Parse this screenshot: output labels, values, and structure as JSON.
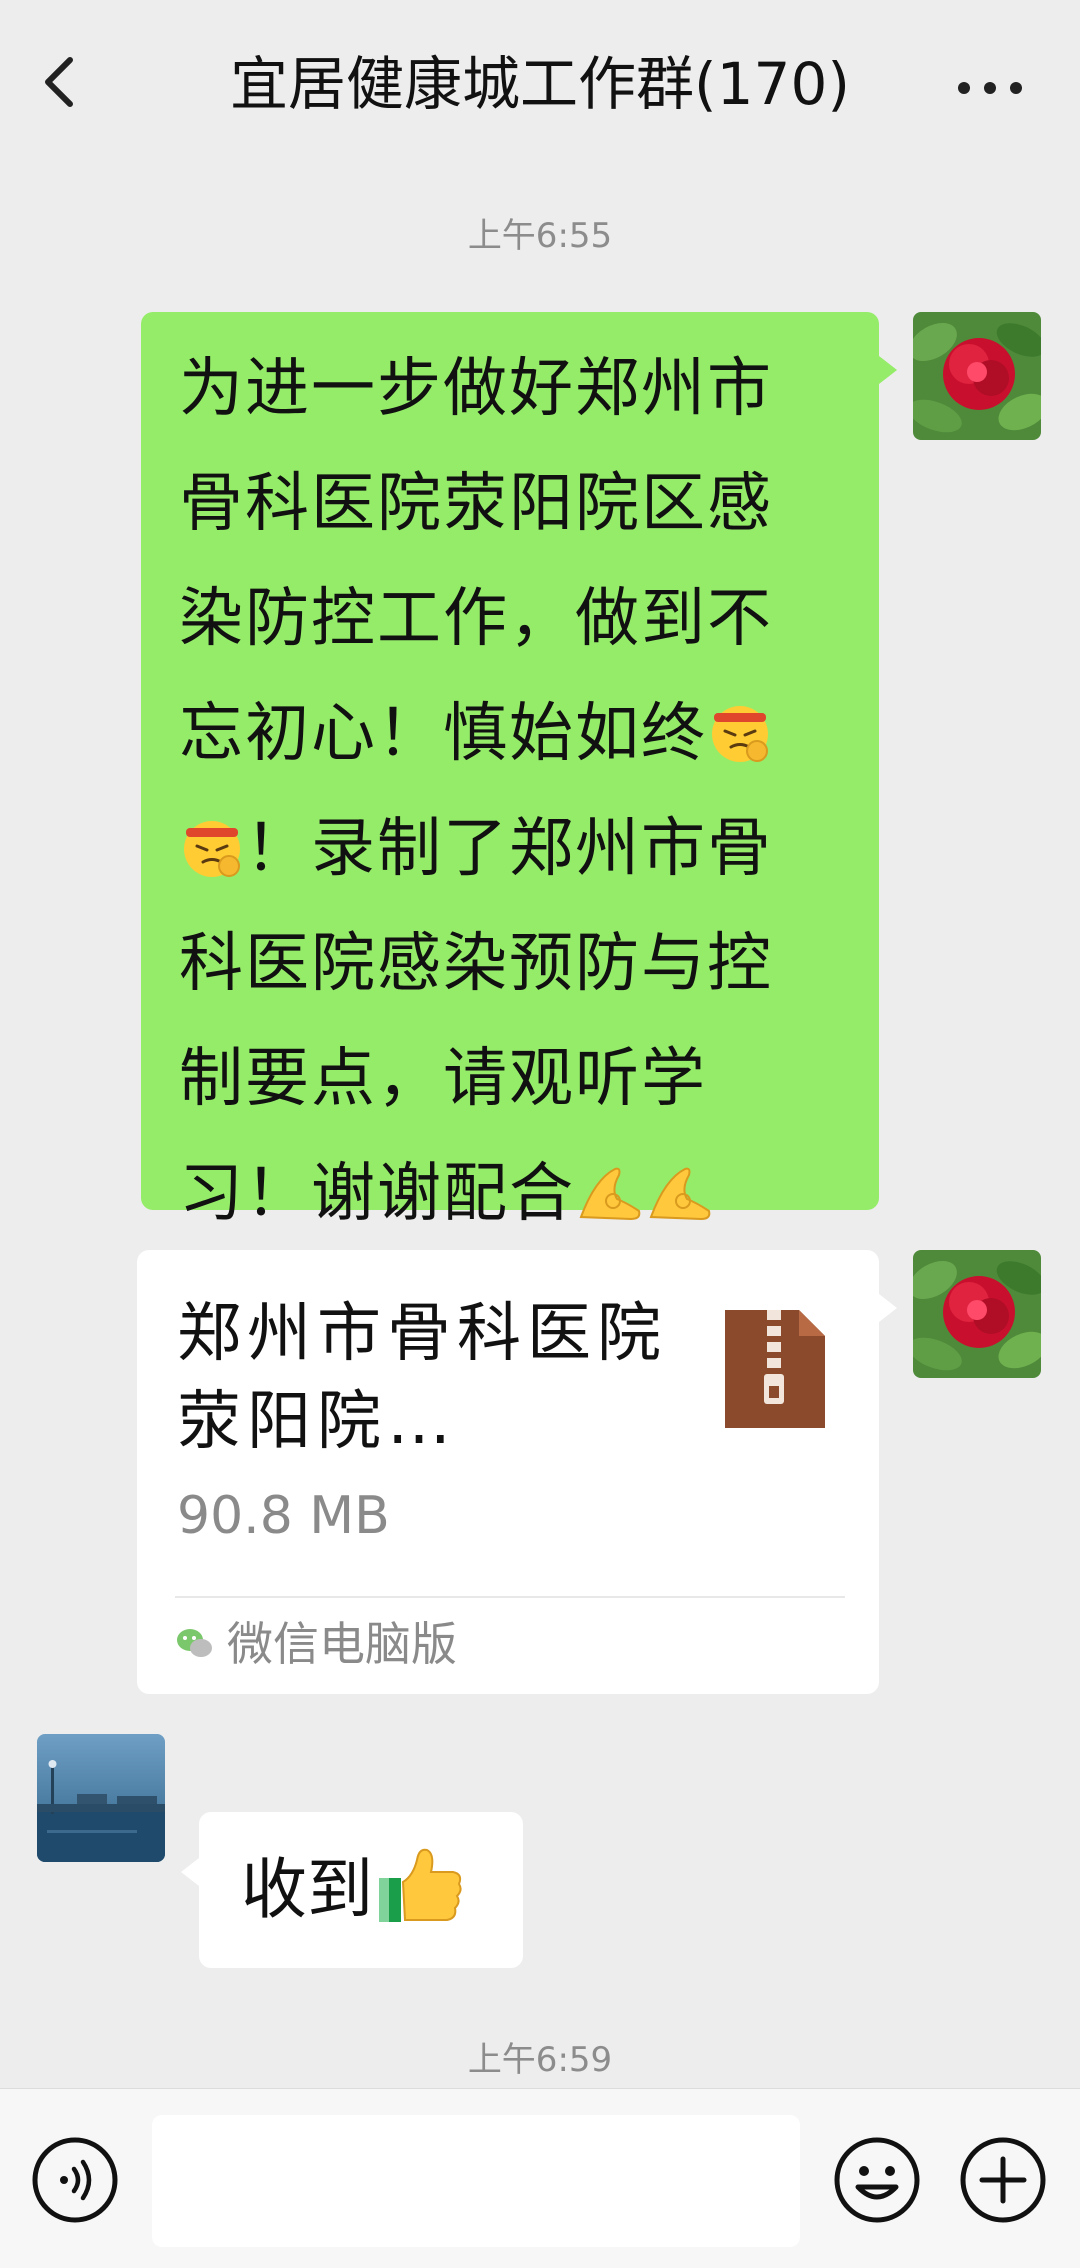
{
  "header": {
    "title": "宜居健康城工作群(170)",
    "back_icon": "chevron-left-icon",
    "more_icon": "ellipsis-icon"
  },
  "messages": {
    "time_1": "上午6:55",
    "outgoing_text": {
      "lines": [
        "为进一步做好郑州市",
        "骨科医院荥阳院区感",
        "染防控工作，做到不",
        "忘初心！慎始如终",
        "！录制了郑州市骨",
        "科医院感染预防与控",
        "制要点，请观听学",
        "习！谢谢配合"
      ],
      "emojis": [
        "determined-face-emoji",
        "determined-face-emoji",
        "ok-hand-emoji",
        "ok-hand-emoji"
      ]
    },
    "file": {
      "name": "郑州市骨科医院荥阳院…",
      "size": "90.8 MB",
      "source": "微信电脑版",
      "icon": "zip-file-icon"
    },
    "reply": {
      "text": "收到",
      "emoji": "thumbs-up-emoji"
    },
    "time_2": "上午6:59"
  },
  "input": {
    "value": "",
    "placeholder": ""
  },
  "colors": {
    "background": "#ededed",
    "outgoing_bubble": "#95ec69",
    "incoming_bubble": "#ffffff",
    "bottom_bar": "#f7f7f7"
  }
}
